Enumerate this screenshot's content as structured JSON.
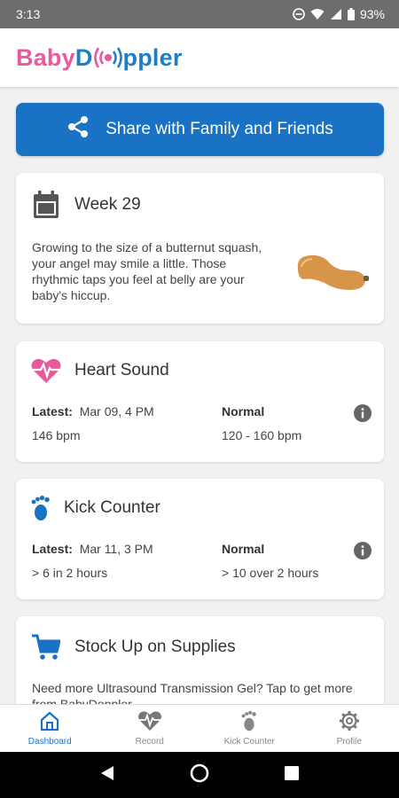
{
  "status_bar": {
    "time": "3:13",
    "battery": "93%"
  },
  "app": {
    "logo_part1": "Baby",
    "logo_part2": "D",
    "logo_part3": "ppler"
  },
  "share": {
    "label": "Share with Family and Friends"
  },
  "week_card": {
    "title": "Week 29",
    "description": "Growing to the size of a butternut squash, your angel may smile a little. Those rhythmic taps you feel at belly are your baby's hiccup."
  },
  "heart_card": {
    "title": "Heart Sound",
    "latest_label": "Latest:",
    "latest_value": "Mar 09, 4 PM",
    "reading": "146 bpm",
    "normal_label": "Normal",
    "normal_range": "120 - 160 bpm"
  },
  "kick_card": {
    "title": "Kick Counter",
    "latest_label": "Latest:",
    "latest_value": "Mar 11, 3 PM",
    "reading": "> 6 in 2 hours",
    "normal_label": "Normal",
    "normal_range": "> 10 over 2 hours"
  },
  "supply_card": {
    "title": "Stock Up on Supplies",
    "description": "Need more Ultrasound Transmission Gel? Tap to get more from BabyDoppler."
  },
  "bottom_nav": {
    "items": [
      {
        "label": "Dashboard",
        "icon": "home-icon"
      },
      {
        "label": "Record",
        "icon": "heartbeat-icon"
      },
      {
        "label": "Kick Counter",
        "icon": "foot-icon"
      },
      {
        "label": "Profile",
        "icon": "gear-icon"
      }
    ],
    "active_index": 0
  },
  "colors": {
    "primary": "#1a72c4",
    "pink": "#e85a9b",
    "logo_blue": "#1e7fc8"
  }
}
